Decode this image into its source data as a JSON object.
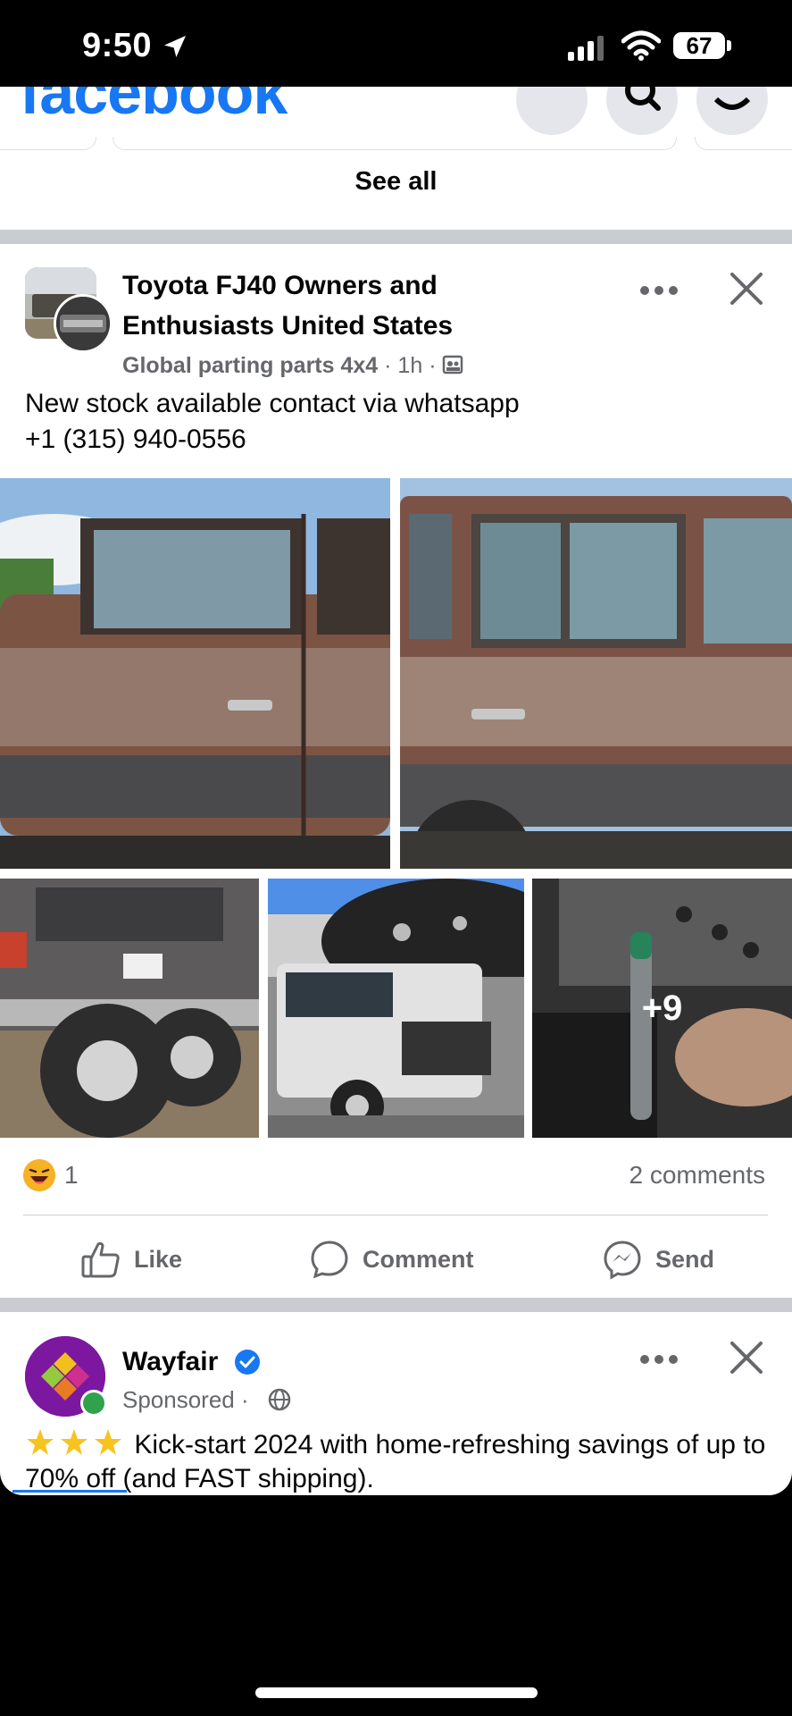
{
  "status_bar": {
    "time": "9:50",
    "battery": "67"
  },
  "header": {
    "logo": "facebook"
  },
  "stories": {
    "see_all_label": "See all"
  },
  "post": {
    "group_name": "Toyota FJ40 Owners and Enthusiasts United States",
    "author": "Global parting parts 4x4",
    "time": "1h",
    "text_line1": "New stock available contact via whatsapp",
    "text_line2": "+1 (315) 940-0556",
    "more_photos": "+9",
    "reaction_count": "1",
    "comments": "2 comments",
    "actions": {
      "like": "Like",
      "comment": "Comment",
      "send": "Send"
    }
  },
  "ad_post": {
    "name": "Wayfair",
    "sponsored": "Sponsored",
    "text": "Kick-start 2024 with home-refreshing savings of up to 70% off (and FAST shipping)."
  },
  "colors": {
    "brand": "#1877f2",
    "secondary_text": "#65676b",
    "divider": "#c9ccd1"
  }
}
